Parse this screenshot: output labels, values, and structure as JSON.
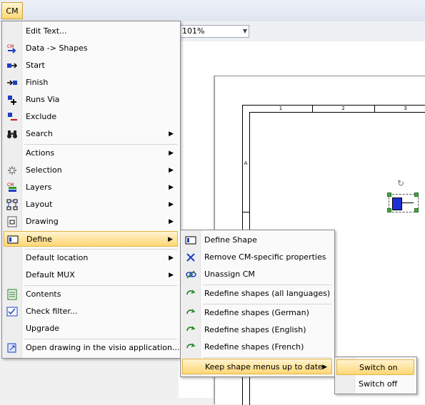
{
  "menubar": {
    "cm_label": "CM"
  },
  "toolbar": {
    "zoom": "101%"
  },
  "drawing": {
    "columns": [
      "1",
      "2",
      "3"
    ],
    "rows": [
      "A"
    ]
  },
  "menu": {
    "items": [
      {
        "label": "Edit Text...",
        "icon": "edit-icon",
        "arrow": false
      },
      {
        "label": "Data -> Shapes",
        "icon": "data-shapes-icon",
        "arrow": false
      },
      {
        "label": "Start",
        "icon": "start-icon",
        "arrow": false
      },
      {
        "label": "Finish",
        "icon": "finish-icon",
        "arrow": false
      },
      {
        "label": "Runs Via",
        "icon": "runs-via-icon",
        "arrow": false
      },
      {
        "label": "Exclude",
        "icon": "exclude-icon",
        "arrow": false
      },
      {
        "label": "Search",
        "icon": "binoculars-icon",
        "arrow": true
      },
      {
        "label": "Actions",
        "icon": "",
        "arrow": true
      },
      {
        "label": "Selection",
        "icon": "selection-icon",
        "arrow": true
      },
      {
        "label": "Layers",
        "icon": "layers-icon",
        "arrow": true
      },
      {
        "label": "Layout",
        "icon": "layout-icon",
        "arrow": true
      },
      {
        "label": "Drawing",
        "icon": "drawing-icon",
        "arrow": true
      },
      {
        "label": "Define",
        "icon": "define-icon",
        "arrow": true
      },
      {
        "label": "Default location",
        "icon": "",
        "arrow": true
      },
      {
        "label": "Default MUX",
        "icon": "",
        "arrow": true
      },
      {
        "label": "Contents",
        "icon": "contents-icon",
        "arrow": false
      },
      {
        "label": "Check filter...",
        "icon": "check-filter-icon",
        "arrow": false
      },
      {
        "label": "Upgrade",
        "icon": "",
        "arrow": false
      },
      {
        "label": "Open drawing in the visio application...",
        "icon": "open-visio-icon",
        "arrow": false
      }
    ]
  },
  "define_menu": {
    "items": [
      {
        "label": "Define Shape",
        "icon": "define-shape-icon"
      },
      {
        "label": "Remove CM-specific properties",
        "icon": "remove-icon"
      },
      {
        "label": "Unassign CM",
        "icon": "unassign-icon"
      },
      {
        "label": "Redefine shapes (all languages)",
        "icon": "redefine-icon"
      },
      {
        "label": "Redefine shapes (German)",
        "icon": "redefine-icon"
      },
      {
        "label": "Redefine shapes (English)",
        "icon": "redefine-icon"
      },
      {
        "label": "Redefine shapes (French)",
        "icon": "redefine-icon"
      },
      {
        "label": "Keep shape menus up to date",
        "icon": ""
      }
    ]
  },
  "keep_menu": {
    "items": [
      {
        "label": "Switch on"
      },
      {
        "label": "Switch off"
      }
    ]
  }
}
